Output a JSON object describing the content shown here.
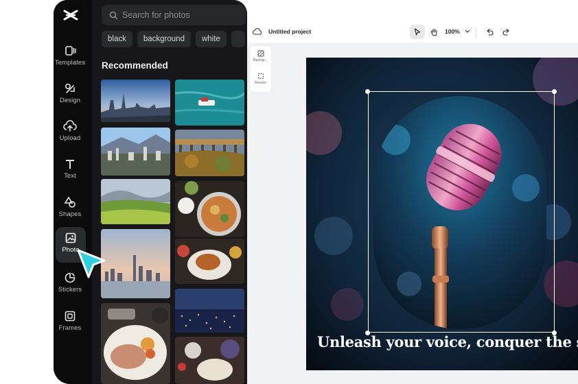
{
  "rail": {
    "items": [
      {
        "label": "Templates",
        "icon": "templates-icon"
      },
      {
        "label": "Design",
        "icon": "design-icon"
      },
      {
        "label": "Upload",
        "icon": "upload-icon"
      },
      {
        "label": "Text",
        "icon": "text-icon"
      },
      {
        "label": "Shapes",
        "icon": "shapes-icon"
      },
      {
        "label": "Photo",
        "icon": "photo-icon"
      },
      {
        "label": "Stickers",
        "icon": "stickers-icon"
      },
      {
        "label": "Frames",
        "icon": "frames-icon"
      }
    ]
  },
  "panel": {
    "search_placeholder": "Search for photos",
    "chips": [
      "black",
      "background",
      "white"
    ],
    "section_title": "Recommended"
  },
  "topbar": {
    "project_title": "Untitled project",
    "zoom": "100%"
  },
  "sidepop": {
    "items": [
      {
        "label": "Backgr...",
        "icon": "background-icon"
      },
      {
        "label": "Resize",
        "icon": "resize-icon"
      }
    ]
  },
  "canvas": {
    "headline": "Unleash your voice, conquer the sta"
  },
  "colors": {
    "rail_bg": "#0b0b0c",
    "panel_bg": "#17171a",
    "cursor": "#2fd0e0",
    "workspace_bg": "#f1f2f4"
  }
}
